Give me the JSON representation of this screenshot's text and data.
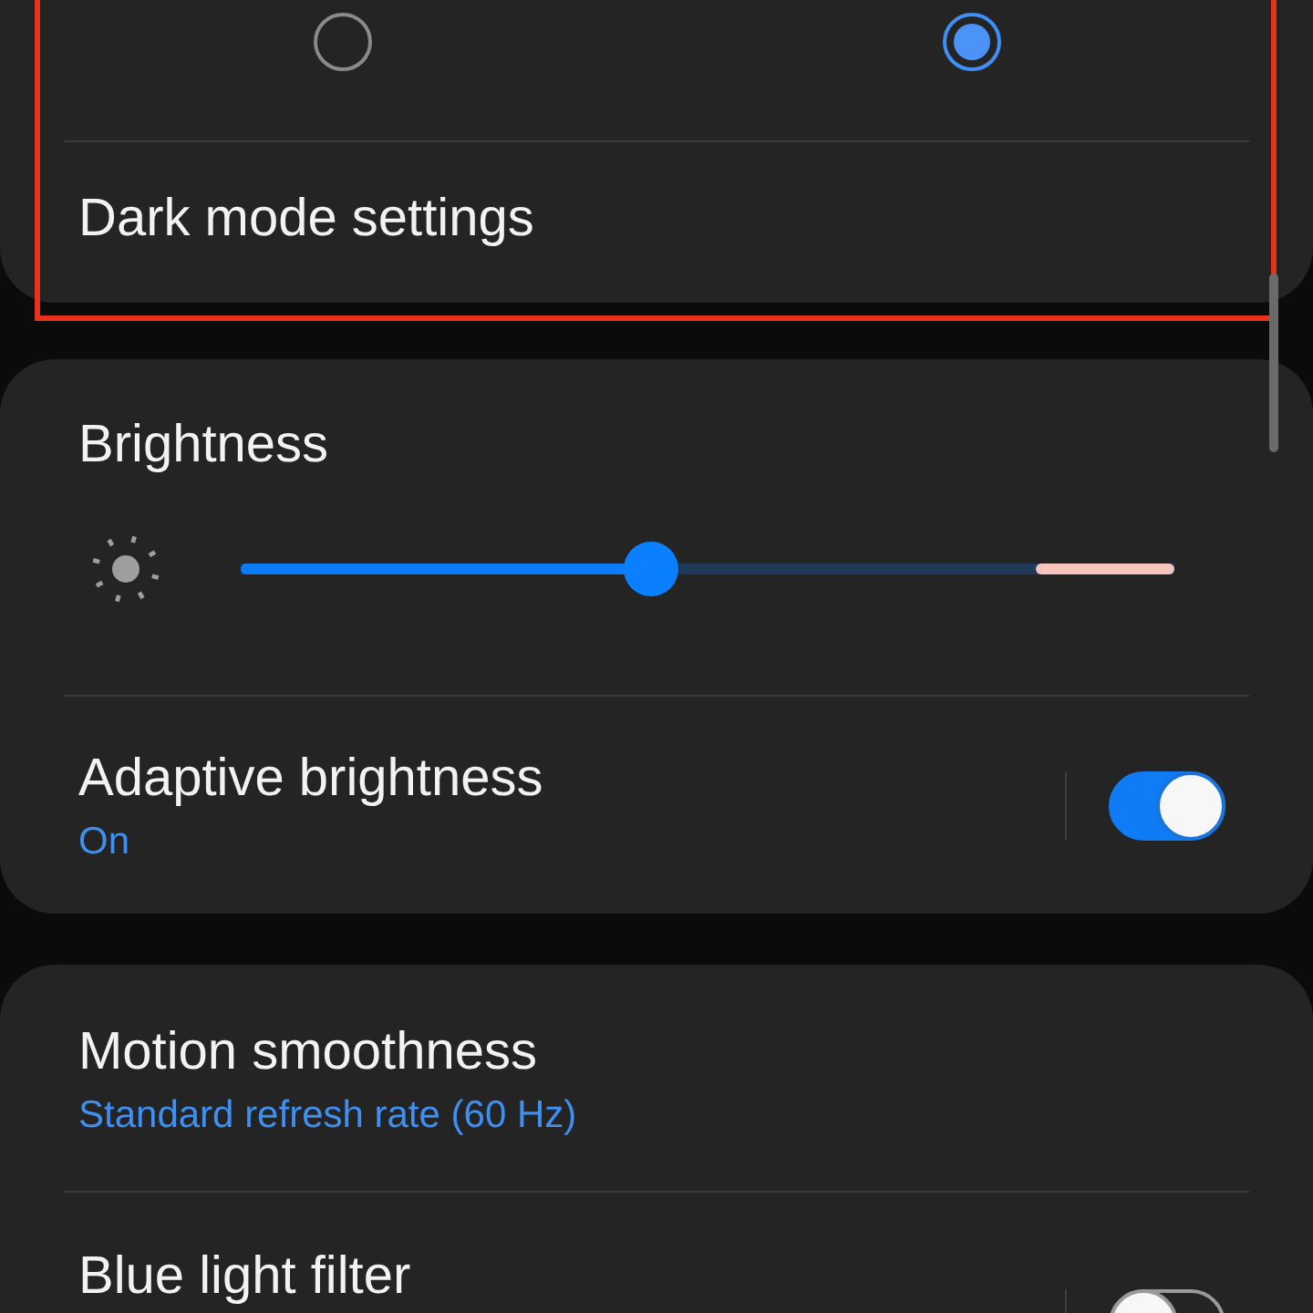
{
  "theme_options": [
    {
      "selected": false
    },
    {
      "selected": true
    }
  ],
  "dark_mode_settings": {
    "label": "Dark mode settings"
  },
  "brightness": {
    "title": "Brightness",
    "level": 0.44
  },
  "adaptive_brightness": {
    "title": "Adaptive brightness",
    "status": "On",
    "on": true
  },
  "motion_smoothness": {
    "title": "Motion smoothness",
    "value": "Standard refresh rate (60 Hz)"
  },
  "blue_light_filter": {
    "title": "Blue light filter",
    "on": false
  }
}
